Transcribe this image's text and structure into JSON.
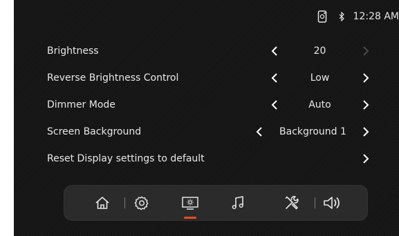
{
  "status_bar": {
    "phone_icon": "phone-icon",
    "bluetooth_icon": "bluetooth-icon",
    "time": "12:28 AM"
  },
  "settings": [
    {
      "label": "Brightness",
      "value": "20",
      "left_enabled": true,
      "right_enabled": false
    },
    {
      "label": "Reverse Brightness Control",
      "value": "Low",
      "left_enabled": true,
      "right_enabled": true
    },
    {
      "label": "Dimmer Mode",
      "value": "Auto",
      "left_enabled": true,
      "right_enabled": true
    },
    {
      "label": "Screen Background",
      "value": "Background 1",
      "left_enabled": true,
      "right_enabled": true
    },
    {
      "label": "Reset Display settings to default",
      "value": "",
      "left_enabled": false,
      "right_enabled": true
    }
  ],
  "dock": {
    "items": [
      "home-icon",
      "settings-gear-icon",
      "display-brightness-icon",
      "music-note-icon",
      "tools-icon",
      "volume-icon"
    ],
    "active": "display-brightness-icon",
    "active_color": "#e84c2b"
  },
  "colors": {
    "background": "#141414",
    "text": "#e8e8e8",
    "dock": "#2b2b2b",
    "accent": "#e84c2b"
  }
}
